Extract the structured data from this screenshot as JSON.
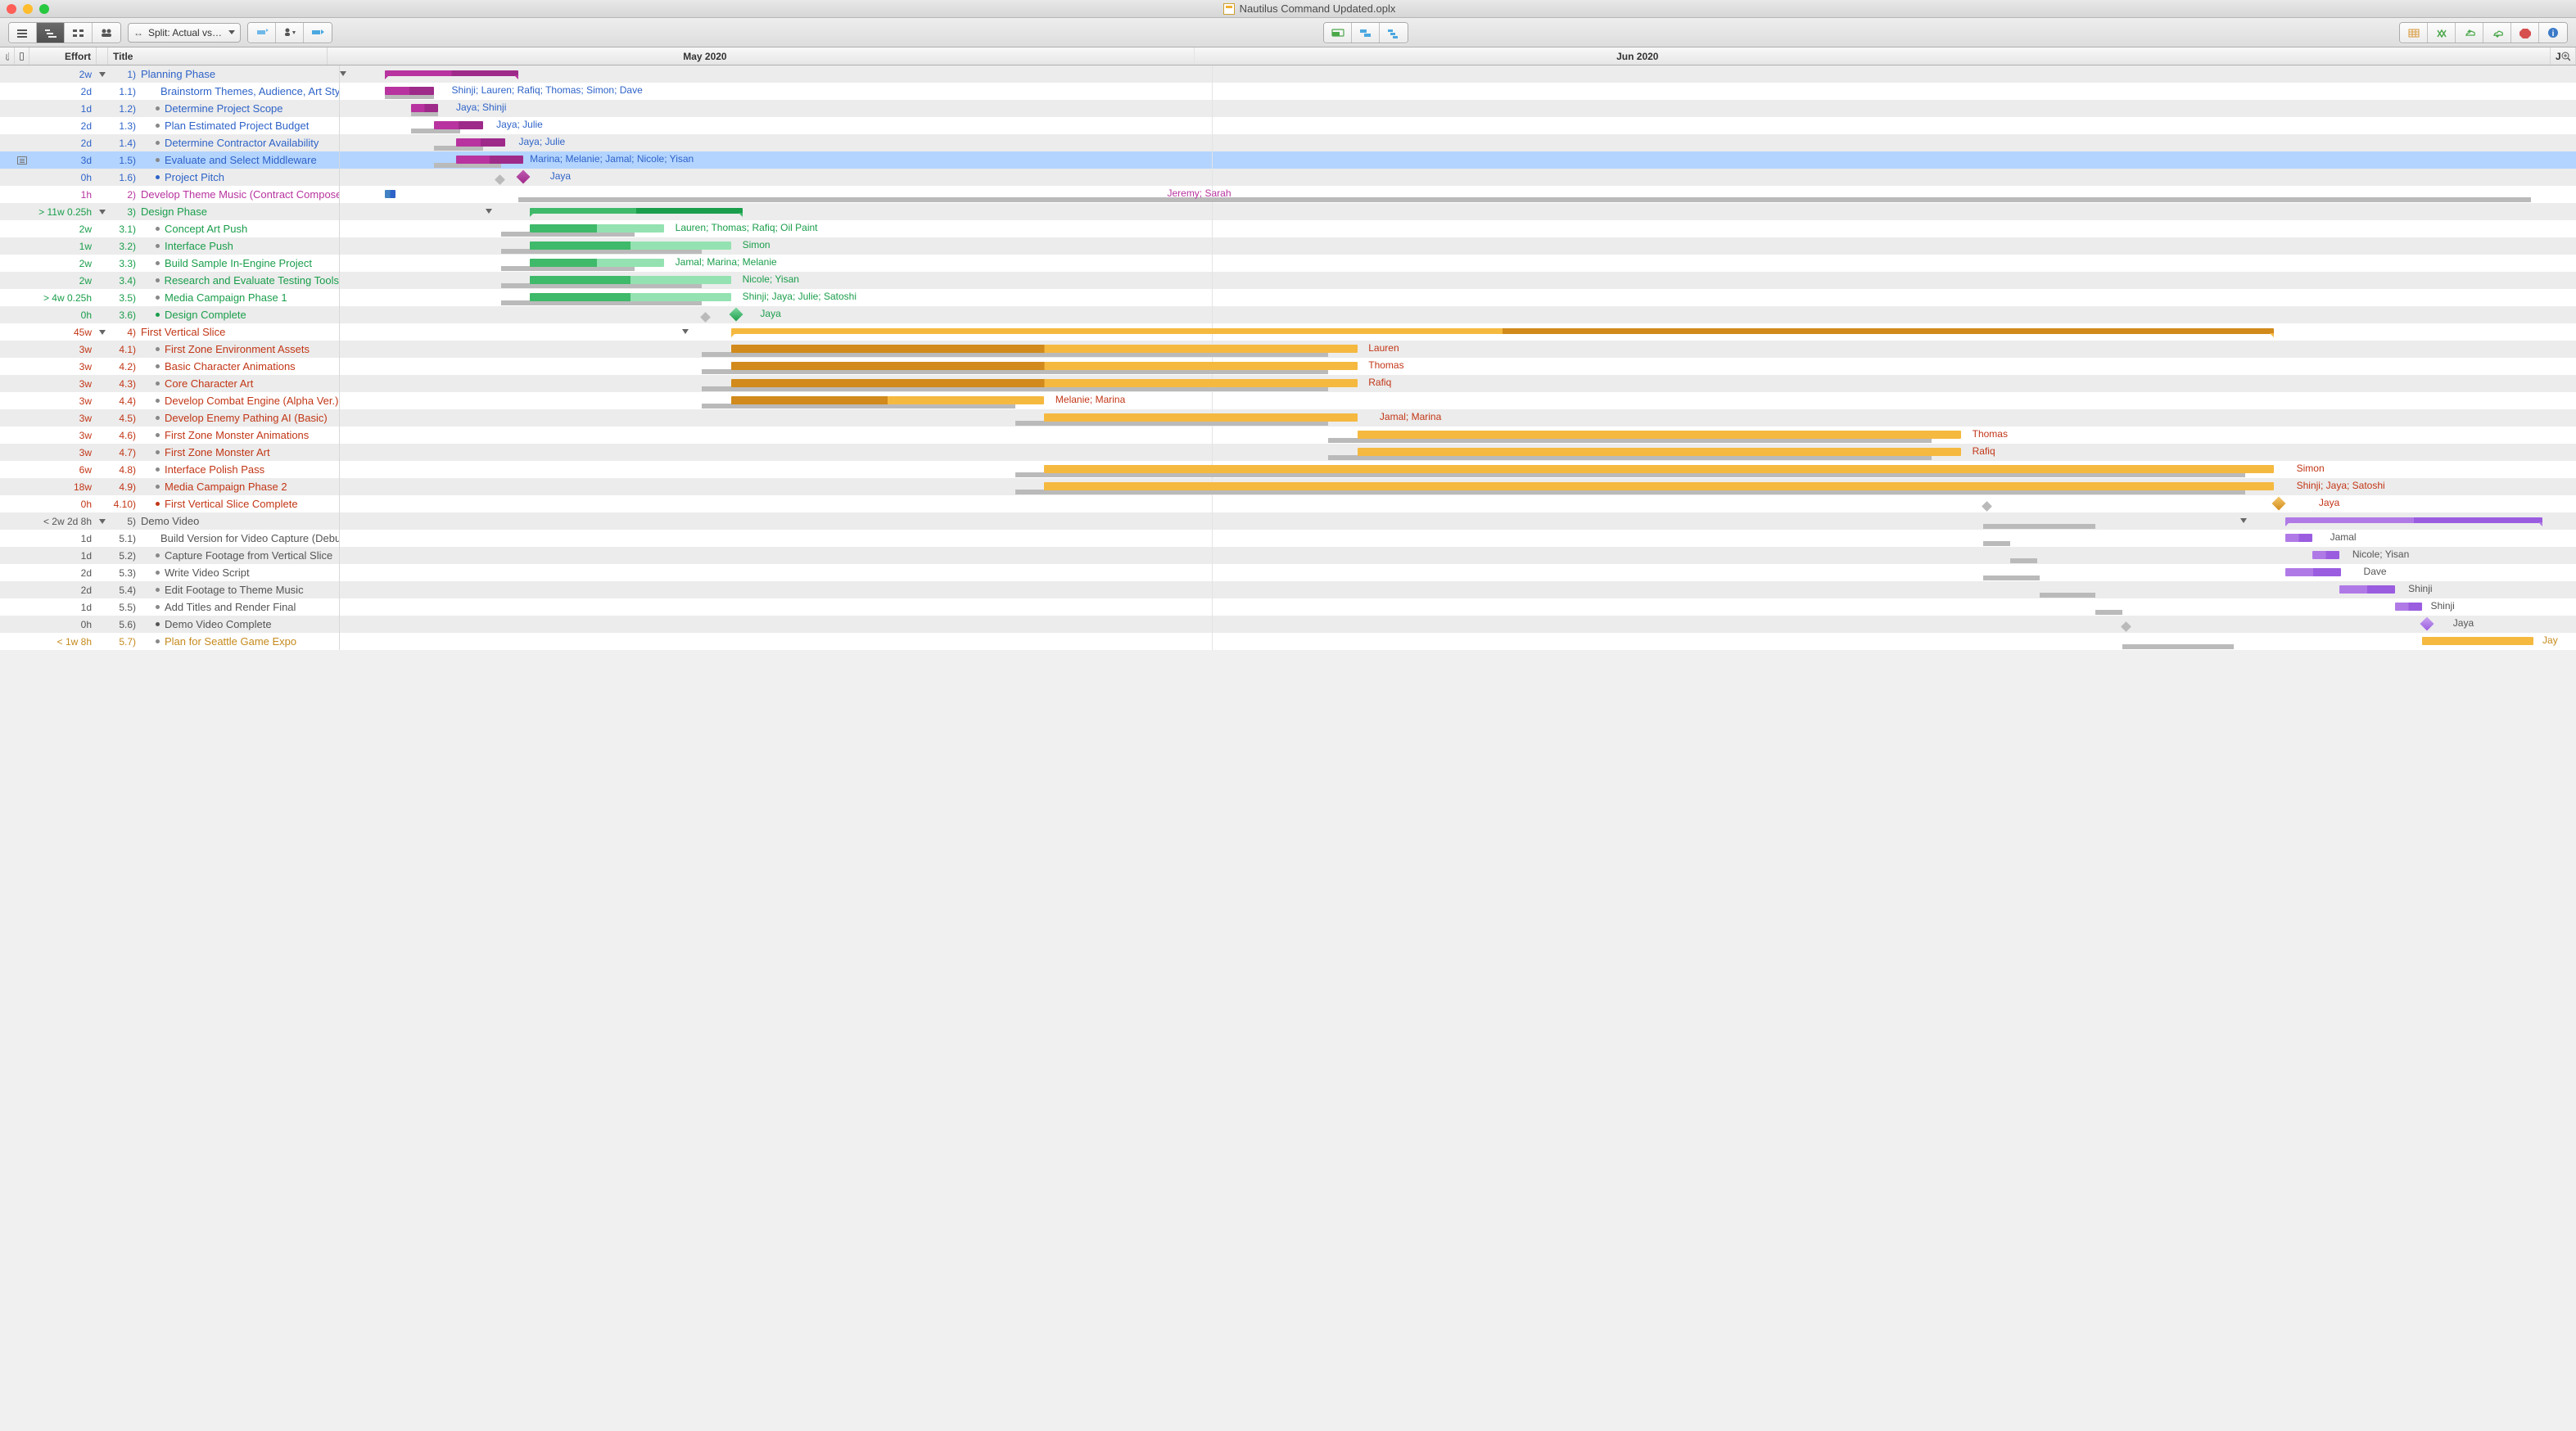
{
  "window_title": "Nautilus Command Updated.oplx",
  "toolbar": {
    "split_label": "Split: Actual vs…"
  },
  "columns": {
    "effort": "Effort",
    "title": "Title",
    "may": "May 2020",
    "jun": "Jun 2020",
    "zoom": "J"
  },
  "selected_index": 5,
  "rows": [
    {
      "effort": "2w",
      "num": "1)",
      "title": "Planning Phase",
      "color": "#2e63c8",
      "disc": true,
      "child": false,
      "bars": [
        {
          "type": "summary",
          "l": 2,
          "w": 6,
          "fillA": "#b8339f",
          "fillB": "#9e2a89"
        }
      ],
      "gtri": 0,
      "note": false
    },
    {
      "effort": "2d",
      "num": "1.1)",
      "title": "Brainstorm Themes, Audience, Art Style",
      "color": "#2e63c8",
      "child": true,
      "dot": true,
      "bars": [
        {
          "l": 2,
          "w": 2.2,
          "fillA": "#b8339f",
          "fillB": "#9e2a89"
        }
      ],
      "baseline": {
        "l": 2,
        "w": 2.2
      },
      "label": "Shinji; Lauren; Rafiq; Thomas; Simon; Dave",
      "lpos": 5
    },
    {
      "effort": "1d",
      "num": "1.2)",
      "title": "Determine Project Scope",
      "color": "#2e63c8",
      "child": true,
      "dot": true,
      "bars": [
        {
          "l": 3.2,
          "w": 1.2,
          "fillA": "#b8339f",
          "fillB": "#9e2a89"
        }
      ],
      "baseline": {
        "l": 3.2,
        "w": 1.2
      },
      "label": "Jaya; Shinji",
      "lpos": 5.2
    },
    {
      "effort": "2d",
      "num": "1.3)",
      "title": "Plan Estimated Project Budget",
      "color": "#2e63c8",
      "child": true,
      "dot": true,
      "bars": [
        {
          "l": 4.2,
          "w": 2.2,
          "fillA": "#b8339f",
          "fillB": "#9e2a89"
        }
      ],
      "baseline": {
        "l": 3.2,
        "w": 2.2
      },
      "label": "Jaya; Julie",
      "lpos": 7
    },
    {
      "effort": "2d",
      "num": "1.4)",
      "title": "Determine Contractor Availability",
      "color": "#2e63c8",
      "child": true,
      "dot": true,
      "bars": [
        {
          "l": 5.2,
          "w": 2.2,
          "fillA": "#b8339f",
          "fillB": "#9e2a89"
        }
      ],
      "baseline": {
        "l": 4.2,
        "w": 2.2
      },
      "label": "Jaya; Julie",
      "lpos": 8
    },
    {
      "effort": "3d",
      "num": "1.5)",
      "title": "Evaluate and Select Middleware",
      "color": "#2e63c8",
      "child": true,
      "dot": true,
      "note": true,
      "bars": [
        {
          "l": 5.2,
          "w": 3,
          "fillA": "#b8339f",
          "fillB": "#9e2a89"
        }
      ],
      "baseline": {
        "l": 4.2,
        "w": 3
      },
      "label": "Marina; Melanie; Jamal; Nicole; Yisan",
      "lpos": 8.5
    },
    {
      "effort": "0h",
      "num": "1.6)",
      "title": "Project Pitch",
      "color": "#2e63c8",
      "child": true,
      "dot_fill": true,
      "milestone": {
        "l": 8,
        "fillA": "#c05bb3",
        "fillB": "#9e2a89"
      },
      "baselinems": {
        "l": 7
      },
      "label": "Jaya",
      "lpos": 9.4
    },
    {
      "effort": "1h",
      "num": "2)",
      "title": "Develop Theme Music (Contract Composer)",
      "color": "#b8339f",
      "child": false,
      "bars": [
        {
          "l": 2,
          "w": 0.5,
          "fillA": "#4183c4",
          "fillB": "#2e63c8"
        }
      ],
      "baseline": {
        "l": 8,
        "w": 90
      },
      "label": "Jeremy; Sarah",
      "lpos": 37,
      "lcolor": "#b8339f"
    },
    {
      "effort": "> 11w 0.25h",
      "num": "3)",
      "title": "Design Phase",
      "color": "#1a9e4b",
      "disc": true,
      "child": false,
      "bars": [
        {
          "type": "summary",
          "l": 8.5,
          "w": 9.5,
          "fillA": "#3fb96a",
          "fillB": "#1a9e4b"
        }
      ],
      "gtri": 6.5
    },
    {
      "effort": "2w",
      "num": "3.1)",
      "title": "Concept Art Push",
      "color": "#1a9e4b",
      "child": true,
      "dot": true,
      "bars": [
        {
          "l": 8.5,
          "w": 6,
          "fillA": "#3fb96a",
          "fillB": "#94e2b1"
        }
      ],
      "baseline": {
        "l": 7.2,
        "w": 6
      },
      "label": "Lauren; Thomas; Rafiq; Oil Paint",
      "lpos": 15
    },
    {
      "effort": "1w",
      "num": "3.2)",
      "title": "Interface Push",
      "color": "#1a9e4b",
      "child": true,
      "dot": true,
      "bars": [
        {
          "l": 8.5,
          "w": 9,
          "fillA": "#3fb96a",
          "fillB": "#94e2b1"
        }
      ],
      "baseline": {
        "l": 7.2,
        "w": 9
      },
      "label": "Simon",
      "lpos": 18
    },
    {
      "effort": "2w",
      "num": "3.3)",
      "title": "Build Sample In-Engine Project",
      "color": "#1a9e4b",
      "child": true,
      "dot": true,
      "bars": [
        {
          "l": 8.5,
          "w": 6,
          "fillA": "#3fb96a",
          "fillB": "#94e2b1"
        }
      ],
      "baseline": {
        "l": 7.2,
        "w": 6
      },
      "label": "Jamal; Marina; Melanie",
      "lpos": 15
    },
    {
      "effort": "2w",
      "num": "3.4)",
      "title": "Research and Evaluate Testing Tools",
      "color": "#1a9e4b",
      "child": true,
      "dot": true,
      "bars": [
        {
          "l": 8.5,
          "w": 9,
          "fillA": "#3fb96a",
          "fillB": "#94e2b1"
        }
      ],
      "baseline": {
        "l": 7.2,
        "w": 9
      },
      "label": "Nicole; Yisan",
      "lpos": 18
    },
    {
      "effort": "> 4w 0.25h",
      "num": "3.5)",
      "title": "Media Campaign Phase 1",
      "color": "#1a9e4b",
      "child": true,
      "dot": true,
      "bars": [
        {
          "l": 8.5,
          "w": 9,
          "fillA": "#3fb96a",
          "fillB": "#94e2b1"
        }
      ],
      "baseline": {
        "l": 7.2,
        "w": 9
      },
      "label": "Shinji; Jaya; Julie; Satoshi",
      "lpos": 18
    },
    {
      "effort": "0h",
      "num": "3.6)",
      "title": "Design Complete",
      "color": "#1a9e4b",
      "child": true,
      "dot_fill": true,
      "milestone": {
        "l": 17.5,
        "fillA": "#7fd9a1",
        "fillB": "#1a9e4b"
      },
      "baselinems": {
        "l": 16.2
      },
      "label": "Jaya",
      "lpos": 18.8
    },
    {
      "effort": "45w",
      "num": "4)",
      "title": "First Vertical Slice",
      "color": "#c23616",
      "disc": true,
      "child": false,
      "bars": [
        {
          "type": "summary",
          "l": 17.5,
          "w": 69,
          "fillA": "#f5b940",
          "fillB": "#d18a1b"
        }
      ],
      "gtri": 15.3
    },
    {
      "effort": "3w",
      "num": "4.1)",
      "title": "First Zone Environment Assets",
      "color": "#c23616",
      "child": true,
      "dot": true,
      "bars": [
        {
          "l": 17.5,
          "w": 28,
          "fillA": "#d18a1b",
          "fillB": "#f5b940"
        }
      ],
      "baseline": {
        "l": 16.2,
        "w": 28
      },
      "label": "Lauren",
      "lpos": 46
    },
    {
      "effort": "3w",
      "num": "4.2)",
      "title": "Basic Character Animations",
      "color": "#c23616",
      "child": true,
      "dot": true,
      "bars": [
        {
          "l": 17.5,
          "w": 28,
          "fillA": "#d18a1b",
          "fillB": "#f5b940"
        }
      ],
      "baseline": {
        "l": 16.2,
        "w": 28
      },
      "label": "Thomas",
      "lpos": 46
    },
    {
      "effort": "3w",
      "num": "4.3)",
      "title": "Core Character Art",
      "color": "#c23616",
      "child": true,
      "dot": true,
      "bars": [
        {
          "l": 17.5,
          "w": 28,
          "fillA": "#d18a1b",
          "fillB": "#f5b940"
        }
      ],
      "baseline": {
        "l": 16.2,
        "w": 28
      },
      "label": "Rafiq",
      "lpos": 46
    },
    {
      "effort": "3w",
      "num": "4.4)",
      "title": "Develop Combat Engine (Alpha Ver.)",
      "color": "#c23616",
      "child": true,
      "dot": true,
      "bars": [
        {
          "l": 17.5,
          "w": 14,
          "fillA": "#d18a1b",
          "fillB": "#f5b940"
        }
      ],
      "baseline": {
        "l": 16.2,
        "w": 14
      },
      "label": "Melanie; Marina",
      "lpos": 32
    },
    {
      "effort": "3w",
      "num": "4.5)",
      "title": "Develop Enemy Pathing AI (Basic)",
      "color": "#c23616",
      "child": true,
      "dot": true,
      "bars": [
        {
          "l": 31.5,
          "w": 14,
          "fillA": "#f5b940",
          "fillB": "#f5b940"
        }
      ],
      "baseline": {
        "l": 30.2,
        "w": 14
      },
      "label": "Jamal; Marina",
      "lpos": 46.5
    },
    {
      "effort": "3w",
      "num": "4.6)",
      "title": "First Zone Monster Animations",
      "color": "#c23616",
      "child": true,
      "dot": true,
      "bars": [
        {
          "l": 45.5,
          "w": 27,
          "fillA": "#f5b940",
          "fillB": "#f5b940"
        }
      ],
      "baseline": {
        "l": 44.2,
        "w": 27
      },
      "label": "Thomas",
      "lpos": 73
    },
    {
      "effort": "3w",
      "num": "4.7)",
      "title": "First Zone Monster Art",
      "color": "#c23616",
      "child": true,
      "dot": true,
      "bars": [
        {
          "l": 45.5,
          "w": 27,
          "fillA": "#f5b940",
          "fillB": "#f5b940"
        }
      ],
      "baseline": {
        "l": 44.2,
        "w": 27
      },
      "label": "Rafiq",
      "lpos": 73
    },
    {
      "effort": "6w",
      "num": "4.8)",
      "title": "Interface Polish Pass",
      "color": "#c23616",
      "child": true,
      "dot": true,
      "bars": [
        {
          "l": 31.5,
          "w": 55,
          "fillA": "#f5b940",
          "fillB": "#f5b940"
        }
      ],
      "baseline": {
        "l": 30.2,
        "w": 55
      },
      "label": "Simon",
      "lpos": 87.5
    },
    {
      "effort": "18w",
      "num": "4.9)",
      "title": "Media Campaign Phase 2",
      "color": "#c23616",
      "child": true,
      "dot": true,
      "bars": [
        {
          "l": 31.5,
          "w": 55,
          "fillA": "#f5b940",
          "fillB": "#f5b940"
        }
      ],
      "baseline": {
        "l": 30.2,
        "w": 55
      },
      "label": "Shinji; Jaya; Satoshi",
      "lpos": 87.5
    },
    {
      "effort": "0h",
      "num": "4.10)",
      "title": "First Vertical Slice Complete",
      "color": "#c23616",
      "child": true,
      "dot_fill": true,
      "milestone": {
        "l": 86.5,
        "fillA": "#f5c96b",
        "fillB": "#d18a1b"
      },
      "baselinems": {
        "l": 73.5
      },
      "label": "Jaya",
      "lpos": 88.5
    },
    {
      "effort": "< 2w 2d 8h",
      "num": "5)",
      "title": "Demo Video",
      "color": "#555",
      "disc": true,
      "child": false,
      "bars": [
        {
          "type": "summary",
          "l": 87,
          "w": 11.5,
          "fillA": "#b07ae6",
          "fillB": "#9a5de0"
        }
      ],
      "baseline": {
        "l": 73.5,
        "w": 5
      },
      "gtri": 85
    },
    {
      "effort": "1d",
      "num": "5.1)",
      "title": "Build Version for Video Capture (Debug Off)",
      "color": "#555",
      "child": true,
      "dot": true,
      "bars": [
        {
          "l": 87,
          "w": 1.2,
          "fillA": "#b07ae6",
          "fillB": "#9a5de0"
        }
      ],
      "baseline": {
        "l": 73.5,
        "w": 1.2
      },
      "label": "Jamal",
      "lpos": 89
    },
    {
      "effort": "1d",
      "num": "5.2)",
      "title": "Capture Footage from Vertical Slice",
      "color": "#555",
      "child": true,
      "dot": true,
      "bars": [
        {
          "l": 88.2,
          "w": 1.2,
          "fillA": "#b07ae6",
          "fillB": "#9a5de0"
        }
      ],
      "baseline": {
        "l": 74.7,
        "w": 1.2
      },
      "label": "Nicole; Yisan",
      "lpos": 90
    },
    {
      "effort": "2d",
      "num": "5.3)",
      "title": "Write Video Script",
      "color": "#555",
      "child": true,
      "dot": true,
      "bars": [
        {
          "l": 87,
          "w": 2.5,
          "fillA": "#b07ae6",
          "fillB": "#9a5de0"
        }
      ],
      "baseline": {
        "l": 73.5,
        "w": 2.5
      },
      "label": "Dave",
      "lpos": 90.5
    },
    {
      "effort": "2d",
      "num": "5.4)",
      "title": "Edit Footage to Theme Music",
      "color": "#555",
      "child": true,
      "dot": true,
      "bars": [
        {
          "l": 89.4,
          "w": 2.5,
          "fillA": "#b07ae6",
          "fillB": "#9a5de0"
        }
      ],
      "baseline": {
        "l": 76,
        "w": 2.5
      },
      "label": "Shinji",
      "lpos": 92.5
    },
    {
      "effort": "1d",
      "num": "5.5)",
      "title": "Add Titles and Render Final",
      "color": "#555",
      "child": true,
      "dot": true,
      "bars": [
        {
          "l": 91.9,
          "w": 1.2,
          "fillA": "#b07ae6",
          "fillB": "#9a5de0"
        }
      ],
      "baseline": {
        "l": 78.5,
        "w": 1.2
      },
      "label": "Shinji",
      "lpos": 93.5
    },
    {
      "effort": "0h",
      "num": "5.6)",
      "title": "Demo Video Complete",
      "color": "#555",
      "child": true,
      "dot_fill": true,
      "milestone": {
        "l": 93.1,
        "fillA": "#c9a5f0",
        "fillB": "#9a5de0"
      },
      "baselinems": {
        "l": 79.7
      },
      "label": "Jaya",
      "lpos": 94.5
    },
    {
      "effort": "< 1w 8h",
      "num": "5.7)",
      "title": "Plan for Seattle Game Expo",
      "color": "#c58a1c",
      "child": true,
      "dot": true,
      "bars": [
        {
          "l": 93.1,
          "w": 5,
          "fillA": "#f5b940",
          "fillB": "#f5b940"
        }
      ],
      "baseline": {
        "l": 79.7,
        "w": 5
      },
      "label": "Jay",
      "lpos": 98.5
    }
  ]
}
